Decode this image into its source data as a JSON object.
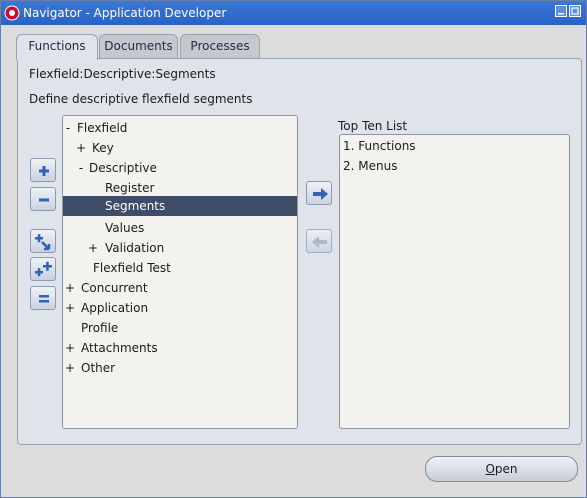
{
  "window": {
    "title": "Navigator - Application Developer"
  },
  "tabs": [
    {
      "label": "Functions",
      "active": true
    },
    {
      "label": "Documents",
      "active": false
    },
    {
      "label": "Processes",
      "active": false
    }
  ],
  "panel": {
    "path": "Flexfield:Descriptive:Segments",
    "description": "Define descriptive flexfield segments"
  },
  "tree": {
    "nodes": [
      {
        "sign": "-",
        "label": "Flexfield",
        "depth": 0,
        "selected": false
      },
      {
        "sign": "+",
        "label": "Key",
        "depth": 1,
        "selected": false
      },
      {
        "sign": "-",
        "label": "Descriptive",
        "depth": 1,
        "selected": false
      },
      {
        "sign": "",
        "label": "Register",
        "depth": 2,
        "selected": false
      },
      {
        "sign": "",
        "label": "Segments",
        "depth": 2,
        "selected": true
      },
      {
        "sign": "",
        "label": "Values",
        "depth": 2,
        "selected": false
      },
      {
        "sign": "+",
        "label": "Validation",
        "depth": 2,
        "selected": false
      },
      {
        "sign": "",
        "label": "Flexfield Test",
        "depth": 1,
        "selected": false
      },
      {
        "sign": "+",
        "label": "Concurrent",
        "depth": 0,
        "selected": false
      },
      {
        "sign": "+",
        "label": "Application",
        "depth": 0,
        "selected": false
      },
      {
        "sign": "",
        "label": "Profile",
        "depth": 0,
        "selected": false
      },
      {
        "sign": "+",
        "label": "Attachments",
        "depth": 0,
        "selected": false
      },
      {
        "sign": "+",
        "label": "Other",
        "depth": 0,
        "selected": false
      }
    ]
  },
  "top_ten": {
    "title": "Top Ten List",
    "items": [
      "1. Functions",
      "2. Menus"
    ]
  },
  "buttons": {
    "open_mnemonic": "O",
    "open_rest": "pen"
  },
  "colors": {
    "title_bar": "#2962c4",
    "selection": "#3f4c68",
    "panel": "#dfe3ea"
  }
}
